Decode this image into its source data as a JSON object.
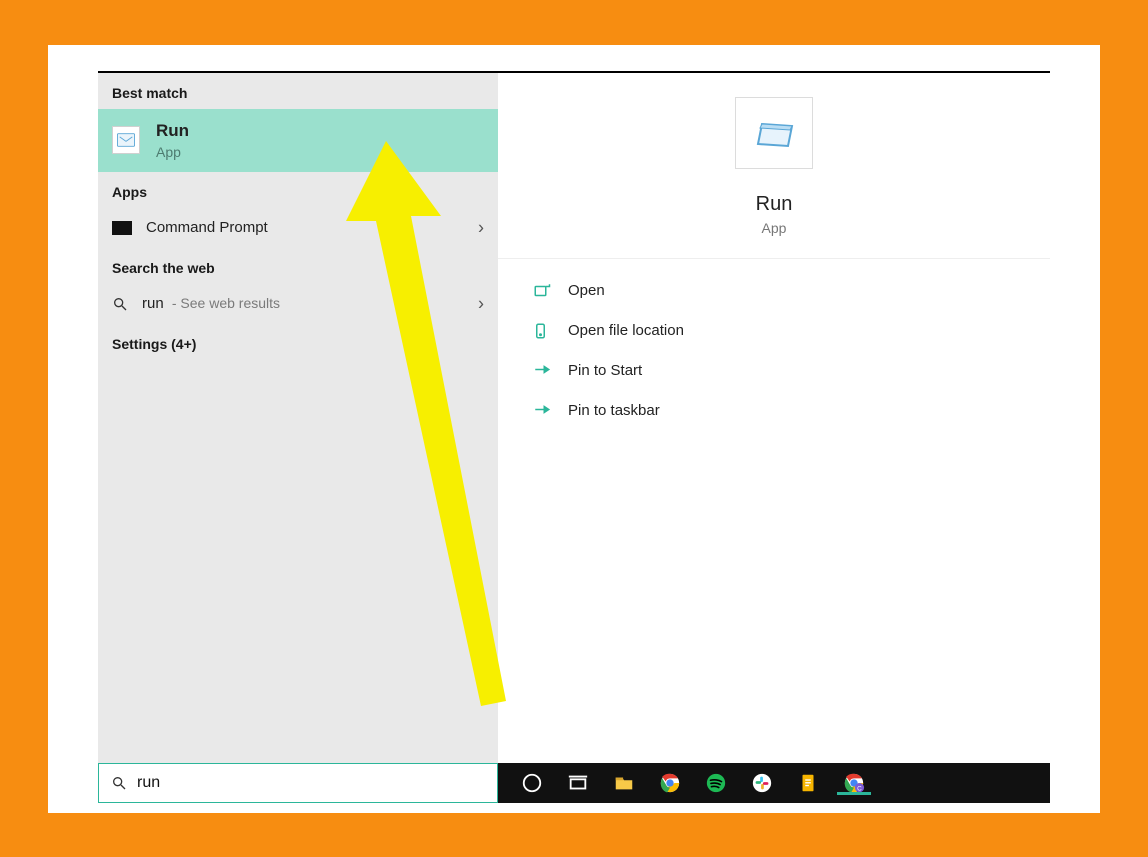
{
  "sections": {
    "best_match": "Best match",
    "apps": "Apps",
    "search_web": "Search the web",
    "settings": "Settings (4+)"
  },
  "best_match_item": {
    "title": "Run",
    "subtitle": "App"
  },
  "apps_list": {
    "cmd": "Command Prompt"
  },
  "web": {
    "term": "run",
    "hint": "- See web results"
  },
  "preview": {
    "title": "Run",
    "subtitle": "App"
  },
  "actions": {
    "open": "Open",
    "open_loc": "Open file location",
    "pin_start": "Pin to Start",
    "pin_taskbar": "Pin to taskbar"
  },
  "search": {
    "value": "run",
    "placeholder": ""
  }
}
